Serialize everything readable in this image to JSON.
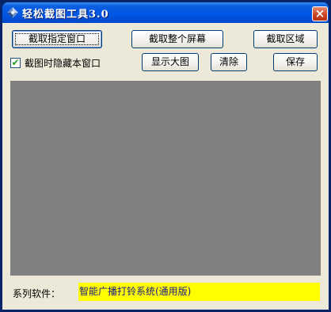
{
  "window": {
    "title": "轻松截图工具3.0",
    "icon": "camera-app-icon",
    "close_glyph": "×"
  },
  "toolbar": {
    "capture_window_label": "截取指定窗口",
    "capture_screen_label": "截取整个屏幕",
    "capture_region_label": "截取区域",
    "show_large_label": "显示大图",
    "clear_label": "清除",
    "save_label": "保存"
  },
  "options": {
    "hide_window_label": "截图时隐藏本窗口",
    "hide_window_checked": true,
    "check_glyph": "✔"
  },
  "preview": {
    "background": "#808080"
  },
  "footer": {
    "label": "系列软件：",
    "link_text": "智能广播打铃系统(通用版)",
    "link_bg": "#ffff00"
  }
}
